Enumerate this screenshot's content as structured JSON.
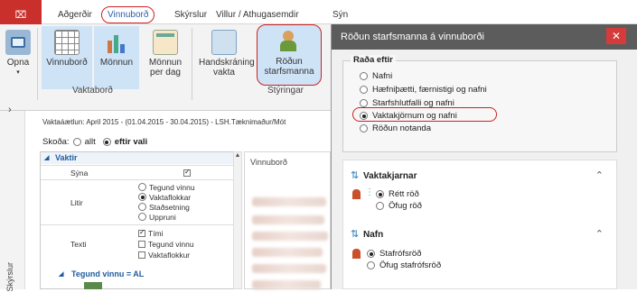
{
  "app": {
    "menu_button": "⌧"
  },
  "menu": {
    "items": [
      "Aðgerðir",
      "Vinnuborð",
      "Skýrslur",
      "Villur / Athugasemdir",
      "Sýn"
    ]
  },
  "ribbon": {
    "buttons": [
      "Opna",
      "Vinnuborð",
      "Mönnun",
      "Mönnun per dag",
      "Handskráning vakta",
      "Röðun starfsmanna"
    ],
    "groups": [
      "Vaktaborð",
      "Stýringar"
    ]
  },
  "left": {
    "plan_text": "Vaktaáætlun: April 2015 - (01.04.2015 - 30.04.2015) - LSH.Tæknimaður/Mót",
    "skoda_label": "Skoða:",
    "skoda_options": [
      "allt",
      "eftir vali"
    ],
    "group_vaktir": "Vaktir",
    "rows": {
      "syna": "Sýna",
      "litir": "Litir",
      "texti": "Texti"
    },
    "litir_options": [
      "Tegund vinnu",
      "Vaktaflokkar",
      "Staðsetning",
      "Uppruni"
    ],
    "texti_options": [
      "Tími",
      "Tegund vinnu",
      "Vaktaflokkur"
    ],
    "group_tegund": "Tegund vinnu = AL",
    "vinnubord_header": "Vinnuborð",
    "side_tab": "Skýrslur"
  },
  "dialog": {
    "title": "Röðun starfsmanna á vinnuborði",
    "close": "✕",
    "rada_eftir": "Raða eftir",
    "rada_options": [
      "Nafni",
      "Hæfniþætti, færnistigi og nafni",
      "Starfshlutfalli og nafni",
      "Vaktakjörnum og nafni",
      "Röðun notanda"
    ],
    "vaktakjarnar_title": "Vaktakjarnar",
    "vaktakjarnar_options": [
      "Rétt röð",
      "Öfug röð"
    ],
    "nafn_title": "Nafn",
    "nafn_options": [
      "Stafrófsröð",
      "Öfug stafrófsröð"
    ]
  }
}
